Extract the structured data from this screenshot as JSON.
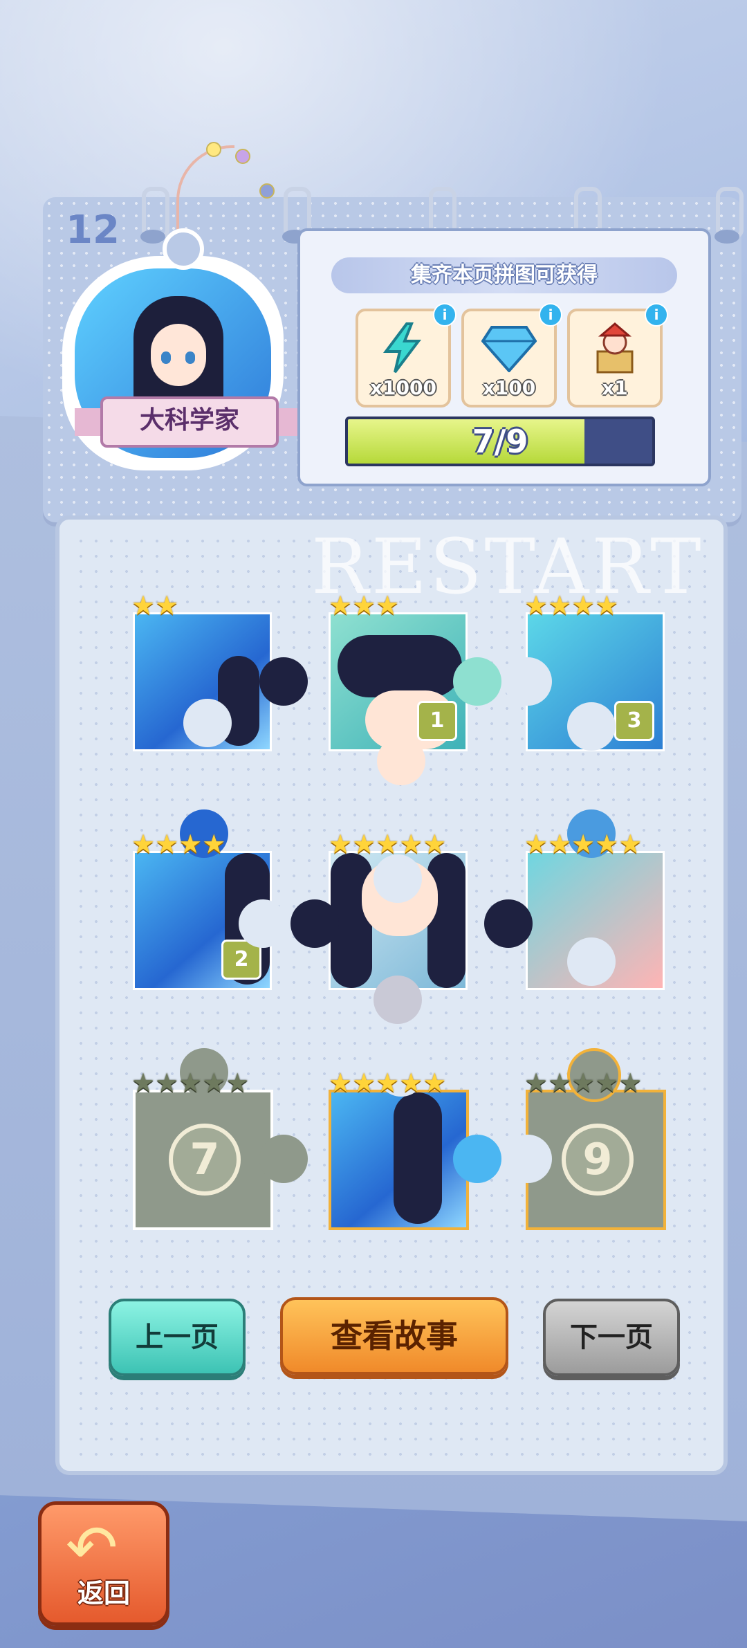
{
  "album": {
    "page_number": "12",
    "character_name": "大科学家",
    "watermark": "RESTART"
  },
  "reward": {
    "title": "集齐本页拼图可获得",
    "items": [
      {
        "icon": "lightning-icon",
        "count": "x1000"
      },
      {
        "icon": "diamond-icon",
        "count": "x100"
      },
      {
        "icon": "jester-gift-icon",
        "count": "x1"
      }
    ],
    "progress_text": "7/9",
    "progress_value": 0.778
  },
  "pieces": [
    {
      "stars": 2,
      "state": "collected"
    },
    {
      "stars": 3,
      "state": "collected",
      "badge": "1"
    },
    {
      "stars": 4,
      "state": "collected",
      "badge": "3"
    },
    {
      "stars": 4,
      "state": "collected",
      "badge": "2"
    },
    {
      "stars": 5,
      "state": "collected"
    },
    {
      "stars": 5,
      "state": "collected"
    },
    {
      "stars": 5,
      "state": "locked",
      "number": "7"
    },
    {
      "stars": 5,
      "state": "collected"
    },
    {
      "stars": 5,
      "state": "locked",
      "number": "9"
    }
  ],
  "buttons": {
    "prev": "上一页",
    "story": "查看故事",
    "next": "下一页",
    "back": "返回"
  },
  "colors": {
    "progress_fill": "#b6d93a",
    "prev_button": "#3dc3b4",
    "story_button": "#f08a2a",
    "next_button": "#9c9c9c",
    "back_button": "#e55a2d"
  }
}
